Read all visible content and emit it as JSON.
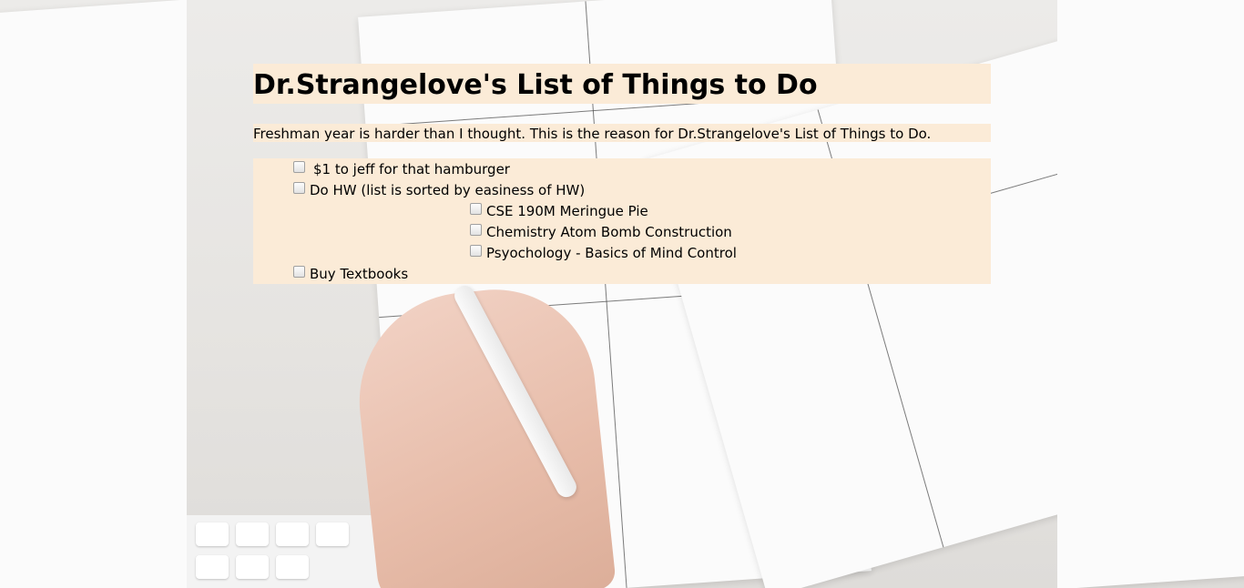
{
  "page": {
    "title": "Dr.Strangelove's List of Things to Do",
    "description": "Freshman year is harder than I thought. This is the reason for Dr.Strangelove's List of Things to Do."
  },
  "todo": {
    "items": [
      {
        "label": "$1 to jeff for that hamburger",
        "checked": false
      },
      {
        "label": "Do HW (list is sorted by easiness of HW)",
        "checked": false
      },
      {
        "label": "CSE 190M Meringue Pie",
        "checked": false
      },
      {
        "label": "Chemistry Atom Bomb Construction",
        "checked": false
      },
      {
        "label": "Psyochology - Basics of Mind Control",
        "checked": false
      },
      {
        "label": "Buy Textbooks",
        "checked": false
      }
    ]
  },
  "colors": {
    "panel_background": "#fbebd7",
    "text": "#000000"
  }
}
